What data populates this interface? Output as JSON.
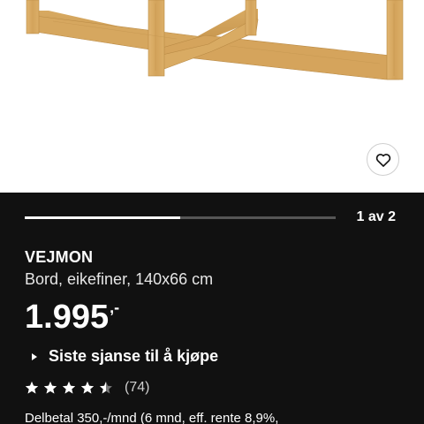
{
  "product": {
    "name": "VEJMON",
    "description": "Bord, eikefiner, 140x66 cm",
    "price": "1.995",
    "price_suffix": ",-",
    "last_chance": "Siste sjanse til å kjøpe",
    "rating": 4.5,
    "rating_max": 5,
    "review_count": "(74)",
    "installment": "Delbetal 350,-/mnd (6 mnd, eff. rente 8,9%,"
  },
  "carousel": {
    "pager": "1 av 2",
    "progress": 0.5
  },
  "icons": {
    "wishlist": "heart-icon",
    "bullet": "triangle-right-icon",
    "star": "star-icon",
    "more": "chevron-right-icon"
  },
  "colors": {
    "panel_bg": "#111111",
    "wood": "#d9ab63",
    "text": "#ffffff"
  }
}
